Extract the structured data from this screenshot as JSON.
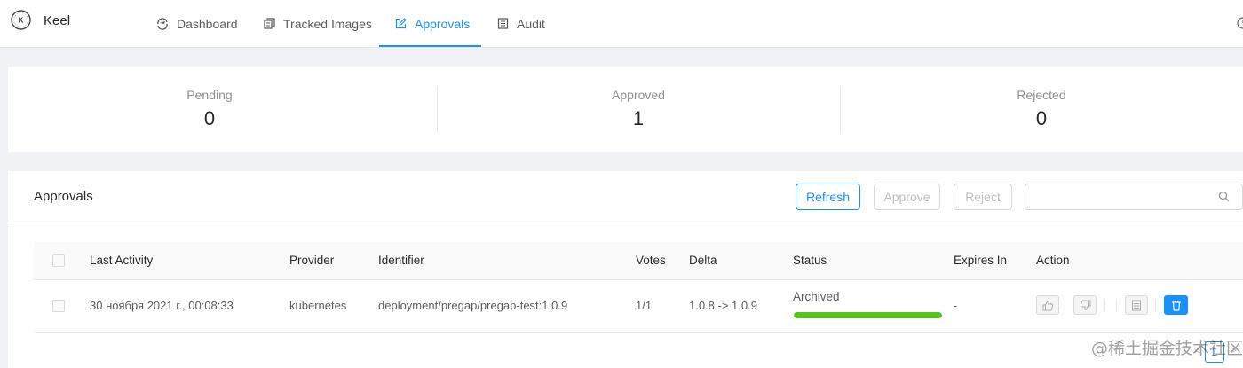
{
  "app": {
    "title": "Keel",
    "logo_letter": "K"
  },
  "nav": {
    "items": [
      {
        "label": "Dashboard",
        "icon": "dashboard-icon"
      },
      {
        "label": "Tracked Images",
        "icon": "images-icon"
      },
      {
        "label": "Approvals",
        "icon": "edit-icon",
        "active": true
      },
      {
        "label": "Audit",
        "icon": "audit-icon"
      }
    ]
  },
  "stats": {
    "pending": {
      "title": "Pending",
      "value": "0"
    },
    "approved": {
      "title": "Approved",
      "value": "1"
    },
    "rejected": {
      "title": "Rejected",
      "value": "0"
    }
  },
  "approvals": {
    "title": "Approvals",
    "buttons": {
      "refresh": "Refresh",
      "approve": "Approve",
      "reject": "Reject"
    },
    "search": {
      "placeholder": "",
      "value": ""
    },
    "columns": [
      "Last Activity",
      "Provider",
      "Identifier",
      "Votes",
      "Delta",
      "Status",
      "Expires In",
      "Action"
    ],
    "rows": [
      {
        "last_activity": "30 ноября 2021 г., 00:08:33",
        "provider": "kubernetes",
        "identifier": "deployment/pregap/pregap-test:1.0.9",
        "votes": "1/1",
        "delta": "1.0.8 -> 1.0.9",
        "status": "Archived",
        "progress": 1.0,
        "expires_in": "-"
      }
    ]
  },
  "pagination": {
    "current": "1",
    "prev": "<",
    "next": ">"
  },
  "watermark": "@稀土掘金技术社区",
  "colors": {
    "accent": "#1890ff",
    "success": "#52c41a",
    "background": "#f0f2f5"
  }
}
